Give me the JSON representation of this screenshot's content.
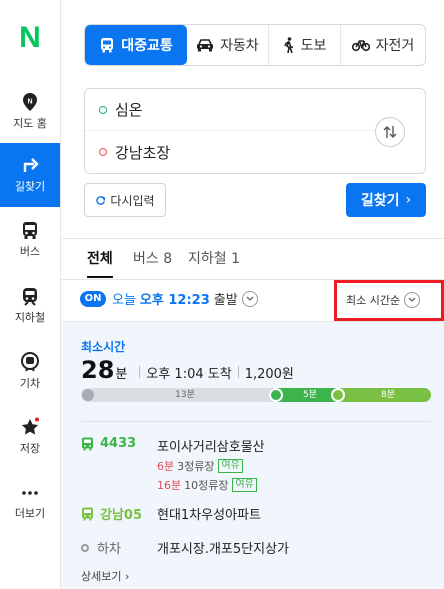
{
  "logo": "N",
  "sidebar": {
    "items": [
      {
        "label": "지도 홈",
        "icon": "map-pin-icon"
      },
      {
        "label": "길찾기",
        "icon": "directions-icon",
        "active": true
      },
      {
        "label": "버스",
        "icon": "bus-icon"
      },
      {
        "label": "지하철",
        "icon": "subway-icon"
      },
      {
        "label": "기차",
        "icon": "train-icon"
      },
      {
        "label": "저장",
        "icon": "star-icon"
      },
      {
        "label": "더보기",
        "icon": "more-icon"
      }
    ]
  },
  "modes": [
    {
      "label": "대중교통",
      "icon": "bus-icon",
      "active": true
    },
    {
      "label": "자동차",
      "icon": "car-icon"
    },
    {
      "label": "도보",
      "icon": "walk-icon"
    },
    {
      "label": "자전거",
      "icon": "bike-icon"
    }
  ],
  "route": {
    "start": "심온",
    "end": "강남초장"
  },
  "reset_label": "다시입력",
  "search_label": "길찾기",
  "result_tabs": [
    {
      "label": "전체",
      "active": true
    },
    {
      "label": "버스 8"
    },
    {
      "label": "지하철 1"
    }
  ],
  "departure": {
    "badge": "ON",
    "today": "오늘",
    "time": "오후 12:23",
    "suffix": "출발"
  },
  "sort_label": "최소 시간순",
  "result": {
    "label": "최소시간",
    "minutes": "28",
    "unit": "분",
    "arrival": "오후 1:04 도착",
    "fare": "1,200원",
    "segments": [
      {
        "type": "walk",
        "label": "13분"
      },
      {
        "type": "bus",
        "label": "5분",
        "color": "#3cb44b"
      },
      {
        "type": "bus",
        "label": "8분",
        "color": "#7ac143"
      }
    ],
    "steps": [
      {
        "route": "4433",
        "stop": "포이사거리삼호물산",
        "arrivals": [
          {
            "time": "6분",
            "rest": "3정류장",
            "tag": "여유"
          },
          {
            "time": "16분",
            "rest": "10정류장",
            "tag": "여유"
          }
        ]
      },
      {
        "route": "강남05",
        "stop": "현대1차우성아파트"
      }
    ],
    "getoff_label": "하차",
    "getoff_stop": "개포시장.개포5단지상가",
    "detail_label": "상세보기"
  }
}
